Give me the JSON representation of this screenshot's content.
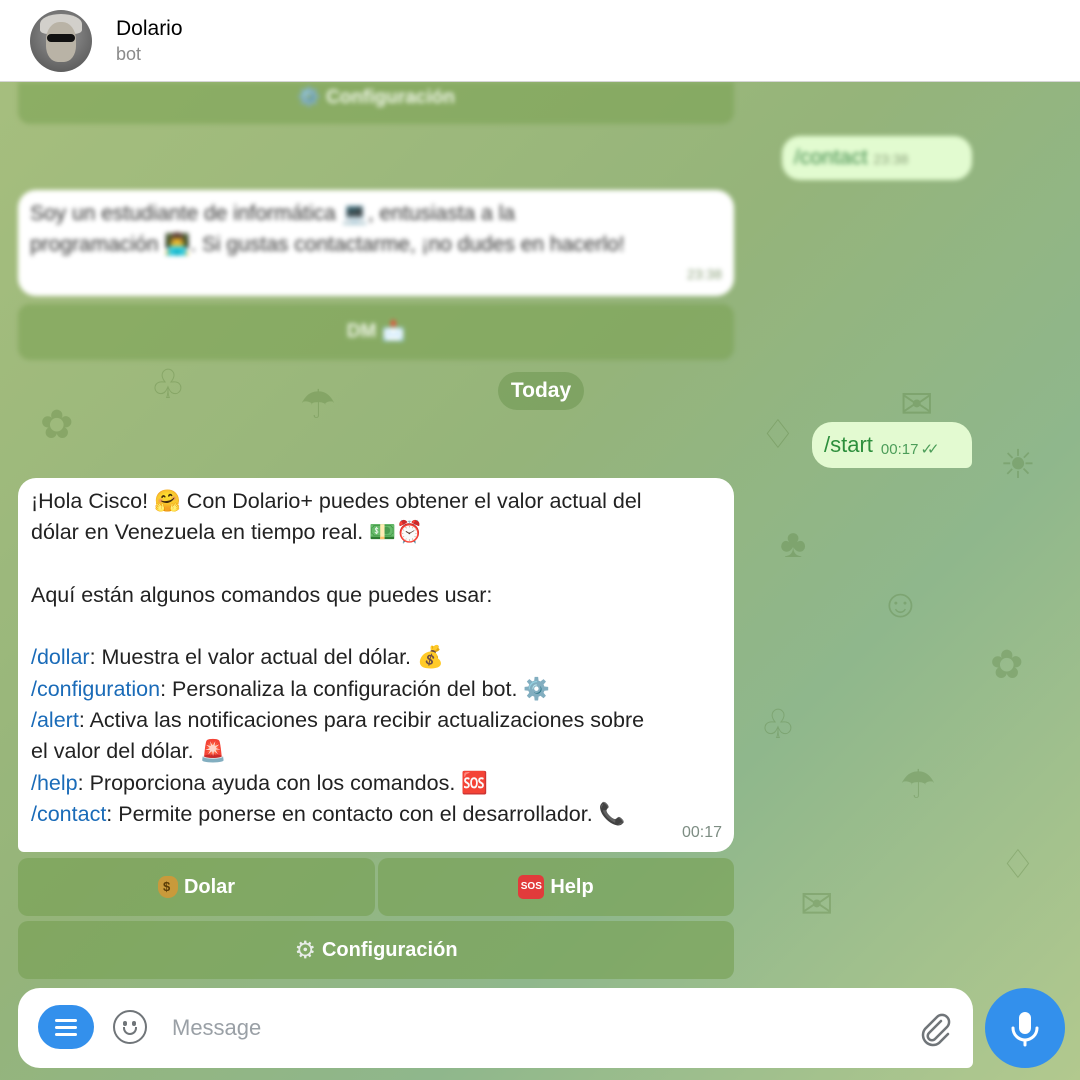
{
  "header": {
    "title": "Dolario",
    "subtitle": "bot"
  },
  "history": {
    "config_button": "⚙️ Configuración",
    "contact_command": "/contact",
    "contact_time": "23:38",
    "contact_reply_line1": "Soy un estudiante de informática 💻, entusiasta a la",
    "contact_reply_line2": "programación 👨‍💻. Si gustas contactarme, ¡no dudes en hacerlo!",
    "contact_reply_time": "23:38",
    "dm_button": "DM 📩"
  },
  "date_divider": "Today",
  "start_message": {
    "text": "/start",
    "time": "00:17"
  },
  "welcome_message": {
    "line1": "¡Hola Cisco! 🤗 Con Dolario+ puedes obtener el valor actual del",
    "line2": "dólar en Venezuela en tiempo real. 💵⏰",
    "line3": "Aquí están algunos comandos que puedes usar:",
    "dollar_cmd": "/dollar",
    "dollar_desc": ": Muestra el valor actual del dólar. 💰",
    "config_cmd": "/configuration",
    "config_desc": ": Personaliza la configuración del bot. ⚙️",
    "alert_cmd": "/alert",
    "alert_desc": ": Activa las notificaciones para recibir actualizaciones sobre",
    "alert_desc2": "el valor del dólar. 🚨",
    "help_cmd": "/help",
    "help_desc": ": Proporciona ayuda con los comandos. 🆘",
    "contact_cmd": "/contact",
    "contact_desc": ": Permite ponerse en contacto con el desarrollador. 📞",
    "time": "00:17"
  },
  "keyboard": {
    "dolar": "Dolar",
    "help": "Help",
    "configuracion": "Configuración"
  },
  "input": {
    "placeholder": "Message"
  },
  "colors": {
    "accent": "#3390ec",
    "outgoing": "#e3fad1",
    "link": "#1a6bb8"
  }
}
